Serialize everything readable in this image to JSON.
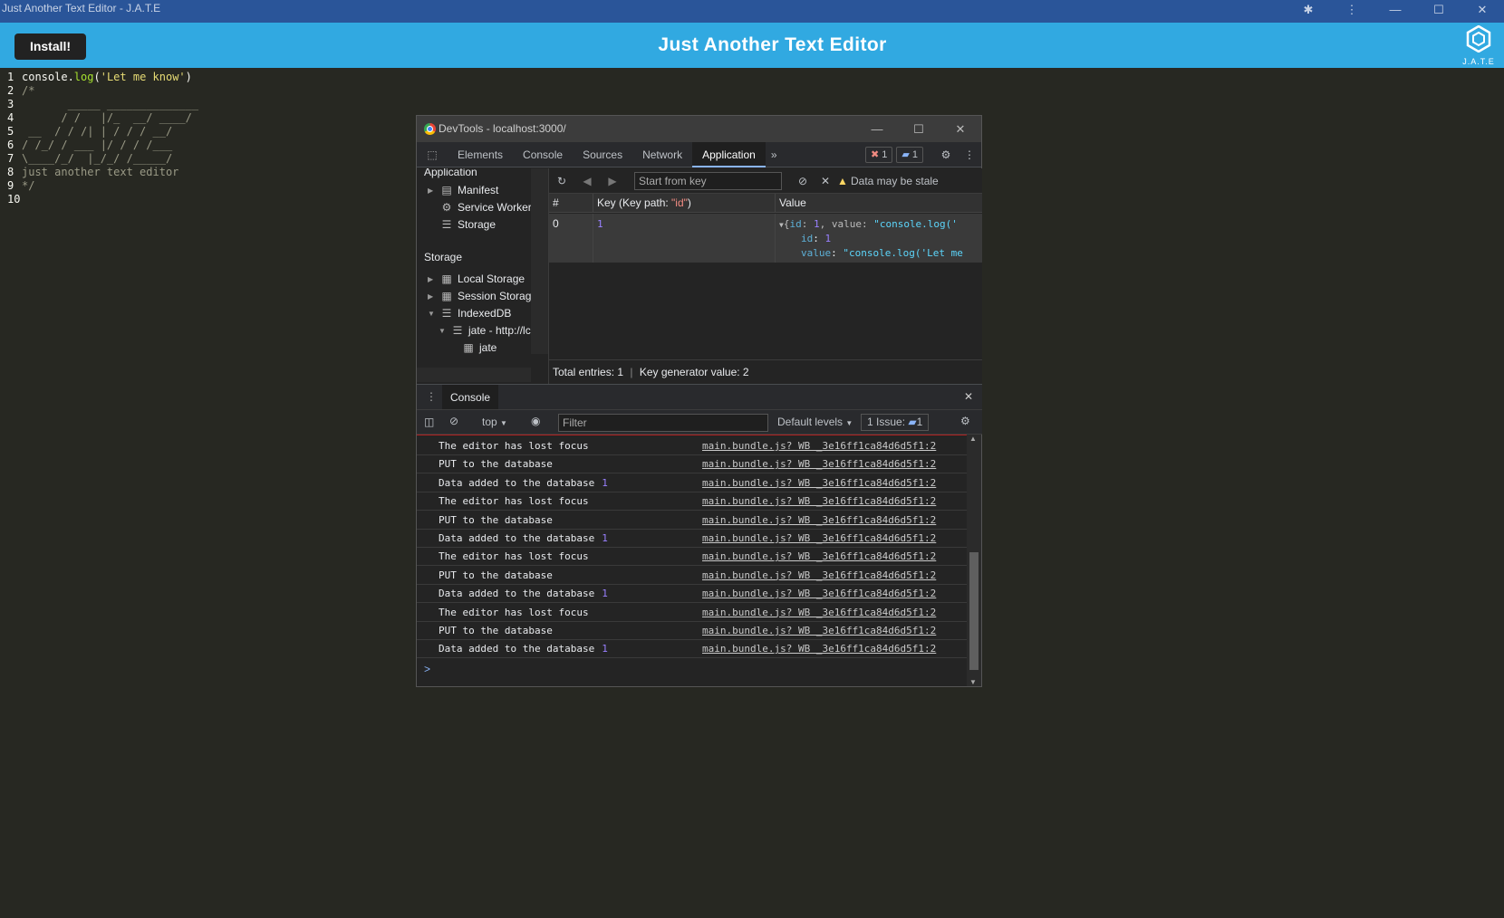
{
  "window": {
    "title": "Just Another Text Editor - J.A.T.E",
    "controls": [
      "puzzle-icon",
      "more-vertical-icon",
      "minimize-icon",
      "maximize-icon",
      "close-icon"
    ]
  },
  "header": {
    "install_label": "Install!",
    "title": "Just Another Text Editor",
    "logo_text": "J.A.T.E",
    "background": "#31a9e1"
  },
  "editor": {
    "lines": [
      {
        "n": "1",
        "text": "console.log('Let me know')"
      },
      {
        "n": "2",
        "text": "/*"
      },
      {
        "n": "3",
        "text": "       _____ ______________"
      },
      {
        "n": "4",
        "text": "      / /   |/_  __/ ____/"
      },
      {
        "n": "5",
        "text": " __  / / /| | / / / __/"
      },
      {
        "n": "6",
        "text": "/ /_/ / ___ |/ / / /___"
      },
      {
        "n": "7",
        "text": "\\____/_/  |_/_/ /_____/"
      },
      {
        "n": "8",
        "text": "just another text editor"
      },
      {
        "n": "9",
        "text": "*/"
      },
      {
        "n": "10",
        "text": ""
      }
    ]
  },
  "devtools": {
    "title": "DevTools - localhost:3000/",
    "tabs": [
      "Elements",
      "Console",
      "Sources",
      "Network",
      "Application"
    ],
    "active_tab": "Application",
    "more_tabs": "»",
    "error_count": "1",
    "message_count": "1",
    "sidebar": {
      "application_heading": "Application",
      "application_items": [
        "Manifest",
        "Service Workers",
        "Storage"
      ],
      "storage_heading": "Storage",
      "storage_items": [
        "Local Storage",
        "Session Storage",
        "IndexedDB",
        "jate - http://lc",
        "jate"
      ]
    },
    "idb": {
      "start_from_key_placeholder": "Start from key",
      "stale_warning": "Data may be stale",
      "col_index": "#",
      "col_key": "Key (Key path: ",
      "col_key_path": "\"id\"",
      "col_key_close": ")",
      "col_value": "Value",
      "row": {
        "index": "0",
        "key": "1",
        "value_summary_open": "{",
        "value_summary_id_key": "id",
        "value_summary_id_val": "1",
        "value_summary_val_key": "value",
        "value_summary_val": "\"console.log('",
        "id_key": "id",
        "id_val": "1",
        "value_key": "value",
        "value_val": "\"console.log('Let me"
      },
      "total_entries": "Total entries: 1",
      "key_generator": "Key generator value: 2"
    },
    "drawer": {
      "tab": "Console",
      "context": "top",
      "filter_placeholder": "Filter",
      "levels": "Default levels",
      "issues_label": "1 Issue:",
      "issues_count": "1"
    },
    "console_rows": [
      {
        "msg": "The editor has lost focus",
        "count": "",
        "src": "main.bundle.js?  WB _3e16ff1ca84d6d5f1:2"
      },
      {
        "msg": "PUT to the database",
        "count": "",
        "src": "main.bundle.js?  WB _3e16ff1ca84d6d5f1:2"
      },
      {
        "msg": "Data added to the database",
        "count": "1",
        "src": "main.bundle.js?  WB _3e16ff1ca84d6d5f1:2"
      },
      {
        "msg": "The editor has lost focus",
        "count": "",
        "src": "main.bundle.js?  WB _3e16ff1ca84d6d5f1:2"
      },
      {
        "msg": "PUT to the database",
        "count": "",
        "src": "main.bundle.js?  WB _3e16ff1ca84d6d5f1:2"
      },
      {
        "msg": "Data added to the database",
        "count": "1",
        "src": "main.bundle.js?  WB _3e16ff1ca84d6d5f1:2"
      },
      {
        "msg": "The editor has lost focus",
        "count": "",
        "src": "main.bundle.js?  WB _3e16ff1ca84d6d5f1:2"
      },
      {
        "msg": "PUT to the database",
        "count": "",
        "src": "main.bundle.js?  WB _3e16ff1ca84d6d5f1:2"
      },
      {
        "msg": "Data added to the database",
        "count": "1",
        "src": "main.bundle.js?  WB _3e16ff1ca84d6d5f1:2"
      },
      {
        "msg": "The editor has lost focus",
        "count": "",
        "src": "main.bundle.js?  WB _3e16ff1ca84d6d5f1:2"
      },
      {
        "msg": "PUT to the database",
        "count": "",
        "src": "main.bundle.js?  WB _3e16ff1ca84d6d5f1:2"
      },
      {
        "msg": "Data added to the database",
        "count": "1",
        "src": "main.bundle.js?  WB _3e16ff1ca84d6d5f1:2"
      }
    ],
    "prompt_symbol": ">"
  }
}
